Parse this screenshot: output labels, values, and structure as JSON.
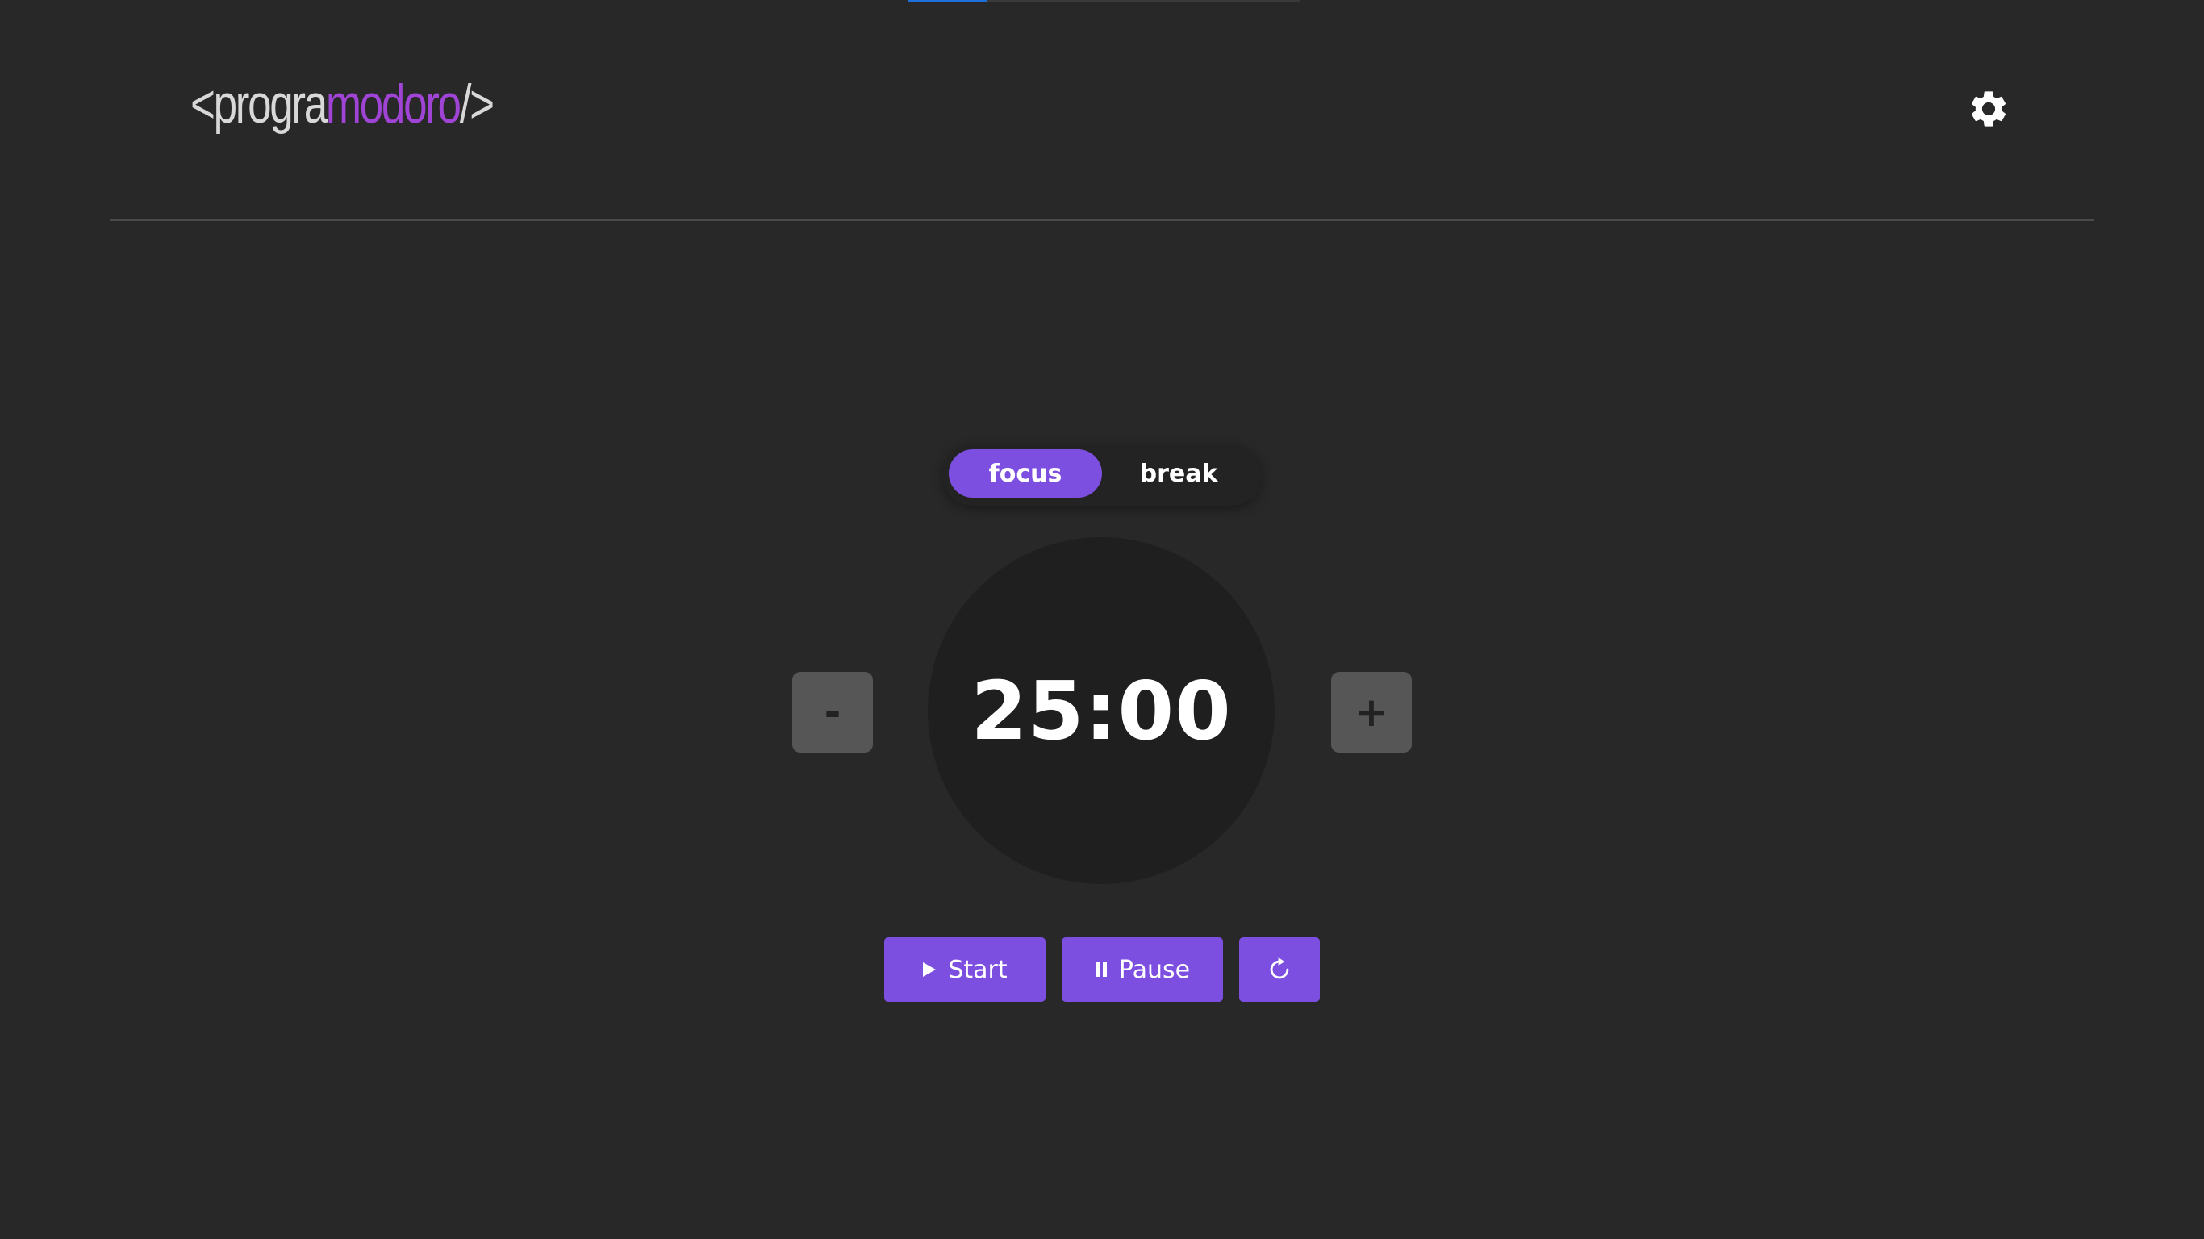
{
  "progress": {
    "value": 0.2
  },
  "header": {
    "logo_open": "<progra",
    "logo_accent": "modoro",
    "logo_close": "/>",
    "settings_icon": "gear-icon"
  },
  "modes": {
    "focus_label": "focus",
    "break_label": "break",
    "active": "focus"
  },
  "timer": {
    "display": "25:00",
    "decrease_label": "-",
    "increase_label": "+"
  },
  "controls": {
    "start_label": "Start",
    "pause_label": "Pause",
    "start_icon": "play-icon",
    "pause_icon": "pause-icon",
    "reset_icon": "reset-icon"
  },
  "colors": {
    "background": "#282828",
    "accent": "#7c4fe0",
    "logo_accent": "#a044d6",
    "progress": "#1e6fd9"
  }
}
